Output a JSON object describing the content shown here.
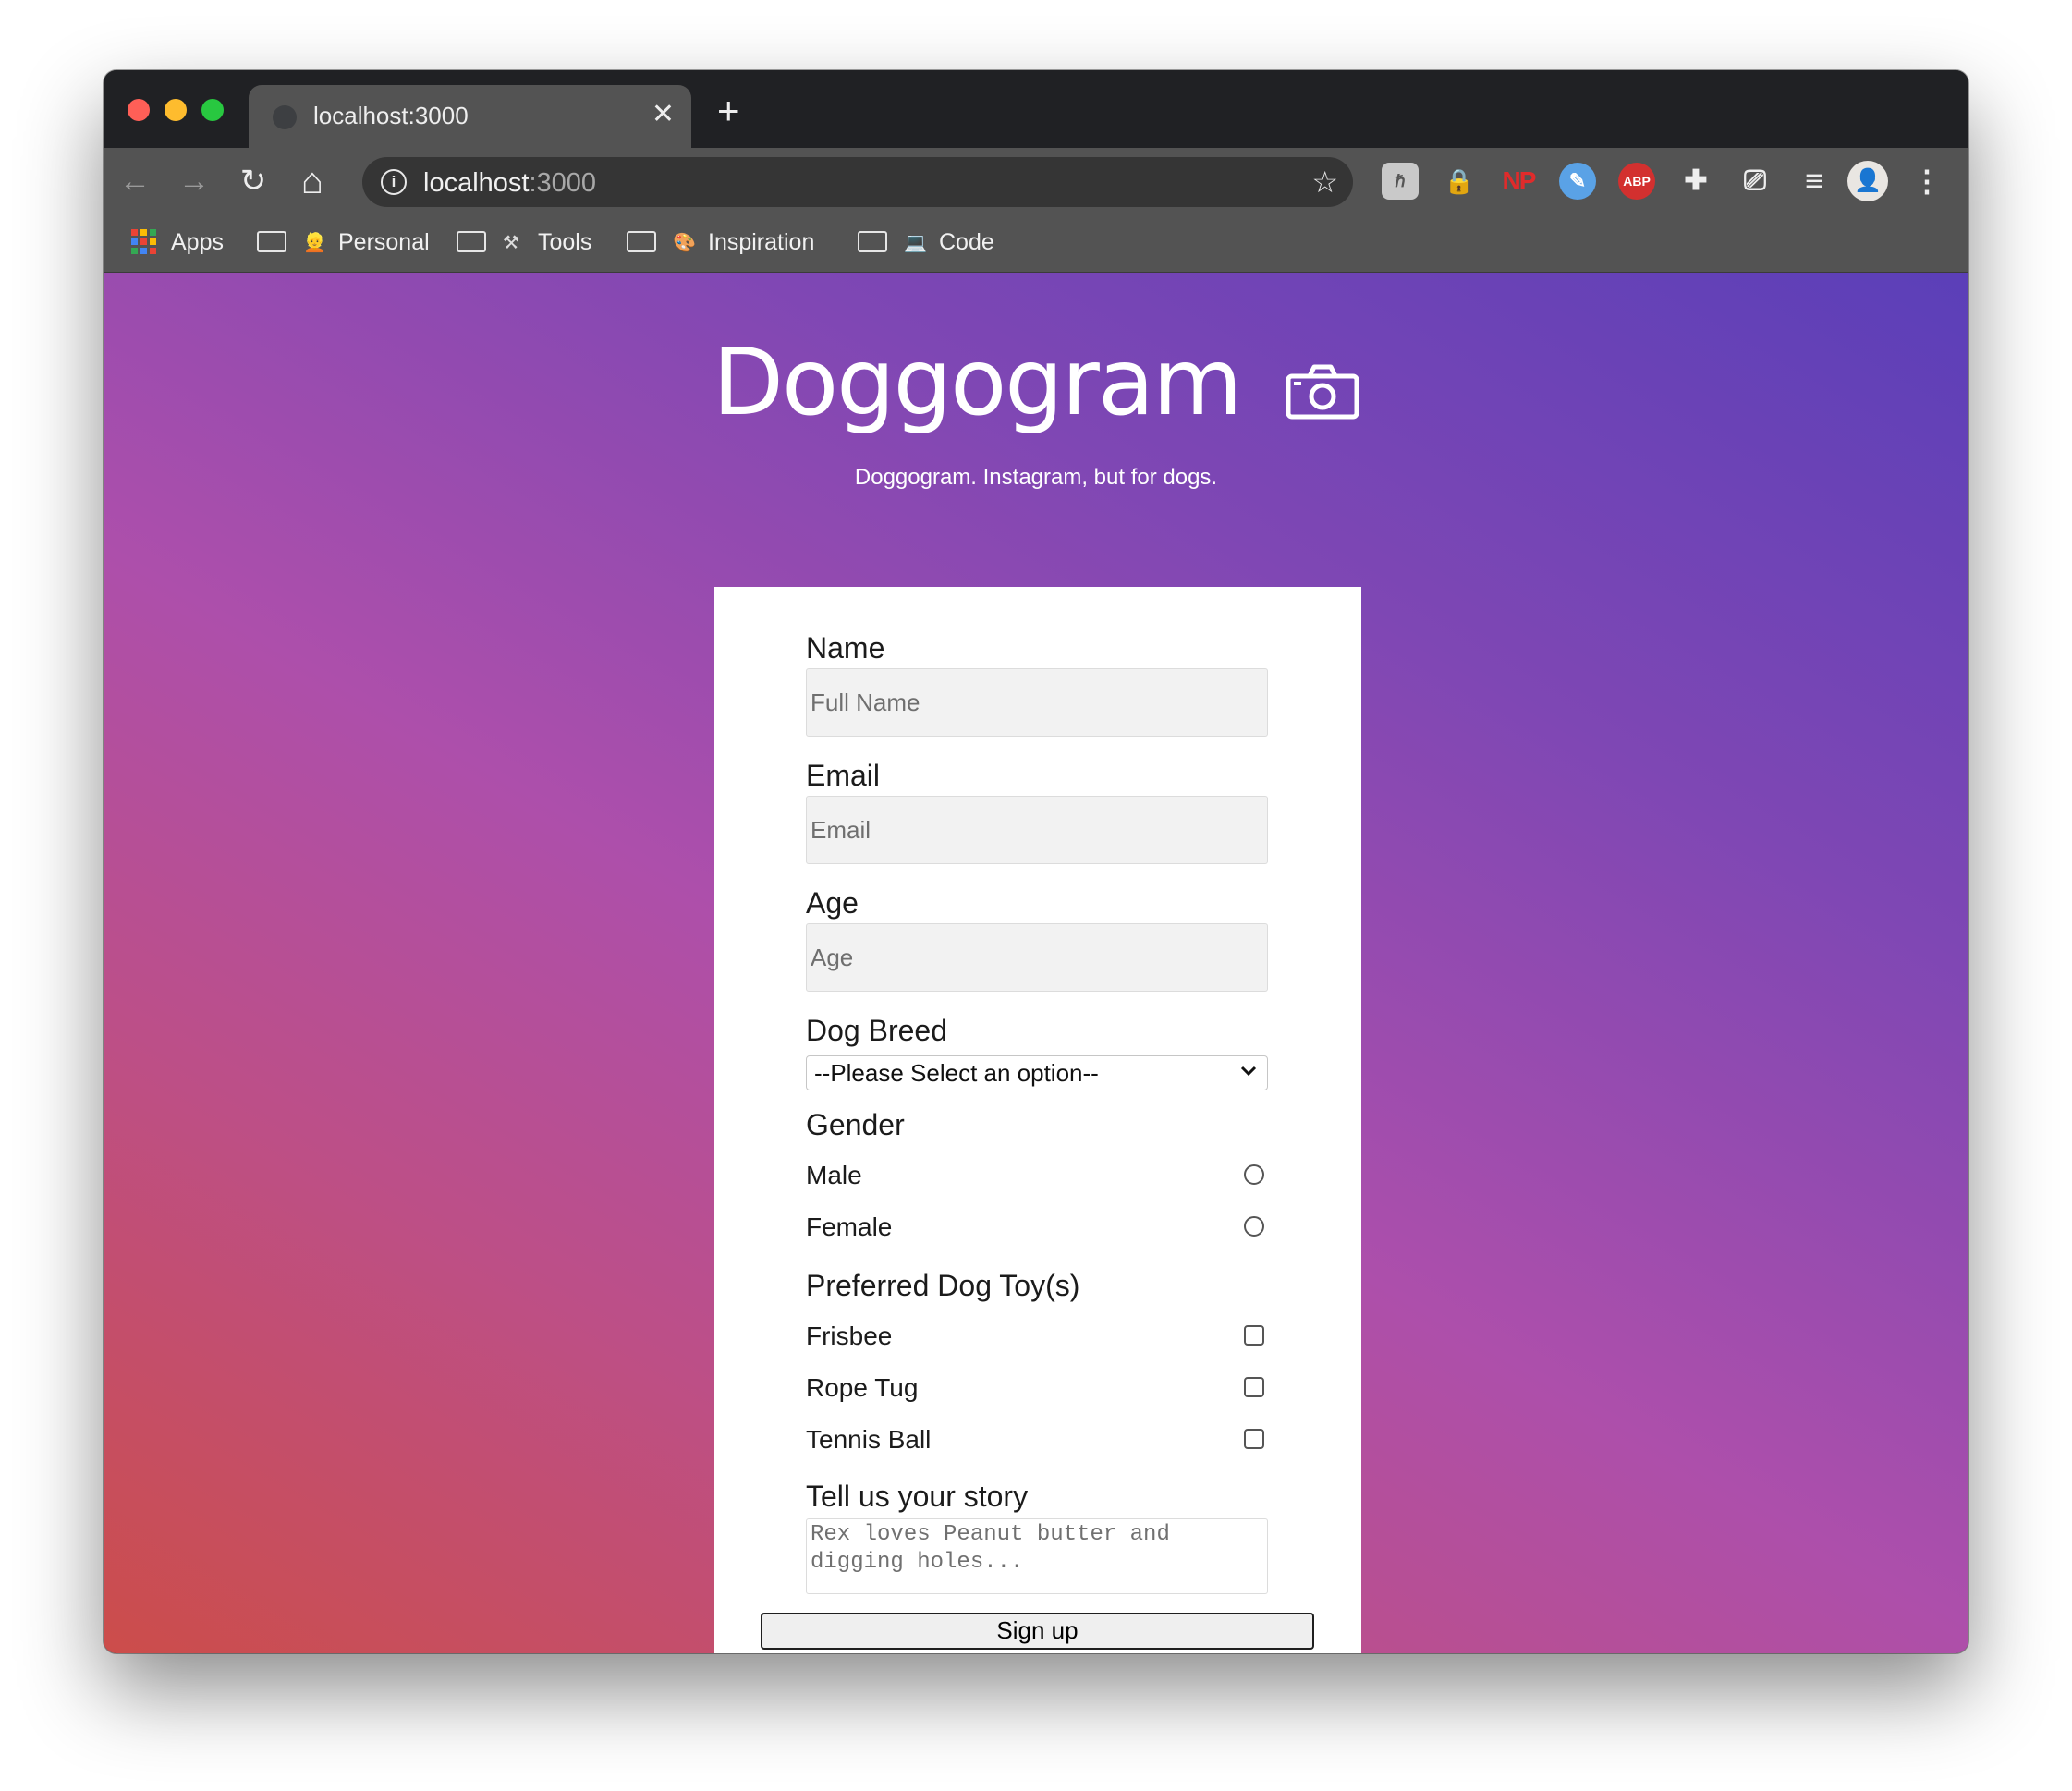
{
  "browser": {
    "tab": {
      "title": "localhost:3000",
      "close": "✕"
    },
    "new_tab": "+",
    "toolbar": {
      "back": "←",
      "forward": "→",
      "reload": "↻",
      "home": "⌂",
      "url_host": "localhost",
      "url_port": ":3000",
      "info": "i",
      "star": "☆"
    },
    "extensions": [
      {
        "name": "hopper-icon",
        "glyph": "ℏ"
      },
      {
        "name": "lock-extension-icon",
        "glyph": "🔒"
      },
      {
        "name": "np-extension-icon",
        "glyph": "NP"
      },
      {
        "name": "pen-extension-icon",
        "glyph": "✎"
      },
      {
        "name": "abp-icon",
        "glyph": "ABP"
      },
      {
        "name": "puzzle-icon",
        "glyph": "✚"
      },
      {
        "name": "cast-icon",
        "glyph": "⎚"
      },
      {
        "name": "media-queue-icon",
        "glyph": "≡"
      },
      {
        "name": "avatar",
        "glyph": "👤"
      },
      {
        "name": "more-icon",
        "glyph": "⋮"
      }
    ],
    "bookmarks": [
      {
        "label": "Apps"
      },
      {
        "label": "Personal",
        "emoji": "👱"
      },
      {
        "label": "Tools",
        "emoji": "⚒"
      },
      {
        "label": "Inspiration",
        "emoji": "🎨"
      },
      {
        "label": "Code",
        "emoji": "💻"
      }
    ]
  },
  "page": {
    "title": "Doggogram",
    "tagline": "Doggogram. Instagram, but for dogs.",
    "form": {
      "name_label": "Name",
      "name_placeholder": "Full Name",
      "email_label": "Email",
      "email_placeholder": "Email",
      "age_label": "Age",
      "age_placeholder": "Age",
      "breed_label": "Dog Breed",
      "breed_selected": "--Please Select an option--",
      "gender_label": "Gender",
      "gender_options": [
        "Male",
        "Female"
      ],
      "toys_label": "Preferred Dog Toy(s)",
      "toy_options": [
        "Frisbee",
        "Rope Tug",
        "Tennis Ball"
      ],
      "story_label": "Tell us your story",
      "story_placeholder": "Rex loves Peanut butter and digging holes...",
      "submit_label": "Sign up"
    }
  },
  "colors": {
    "gradient_red": "#cc4d4a",
    "gradient_pink": "#ad4fab",
    "gradient_purple": "#5b3fb8",
    "chrome_dark": "#202124",
    "chrome_toolbar": "#535353"
  }
}
